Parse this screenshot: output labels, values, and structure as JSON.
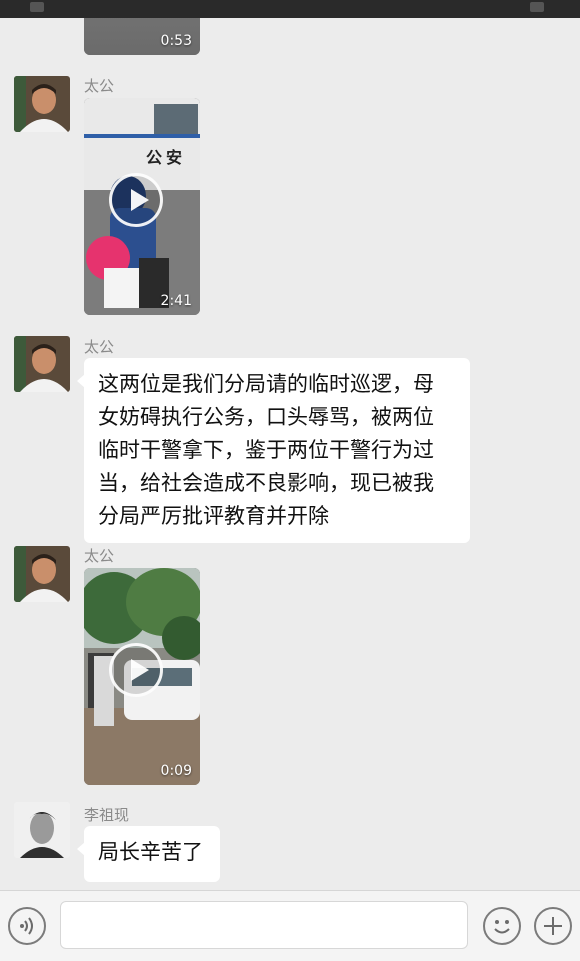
{
  "colors": {
    "background": "#ececec",
    "bubble": "#ffffff",
    "sender": "#8a8a8a",
    "status_bar": "#2a2a2a"
  },
  "messages": [
    {
      "type": "video",
      "duration": "0:53"
    },
    {
      "type": "video",
      "sender": "太公",
      "duration": "2:41",
      "vehicle_text": "公安"
    },
    {
      "type": "text",
      "sender": "太公",
      "lines": [
        "这两位是我们分局请的临时巡逻，母",
        "女妨碍执行公务，口头辱骂，被两位",
        "临时干警拿下，鉴于两位干警行为过",
        "当，给社会造成不良影响，现已被我",
        "分局严厉批评教育并开除"
      ]
    },
    {
      "type": "video",
      "sender": "太公",
      "duration": "0:09"
    },
    {
      "type": "text",
      "sender": "李祖现",
      "lines": [
        "局长辛苦了"
      ]
    }
  ],
  "input_bar": {
    "voice_icon": "voice-icon",
    "emoji_icon": "emoji-icon",
    "plus_icon": "plus-icon"
  }
}
